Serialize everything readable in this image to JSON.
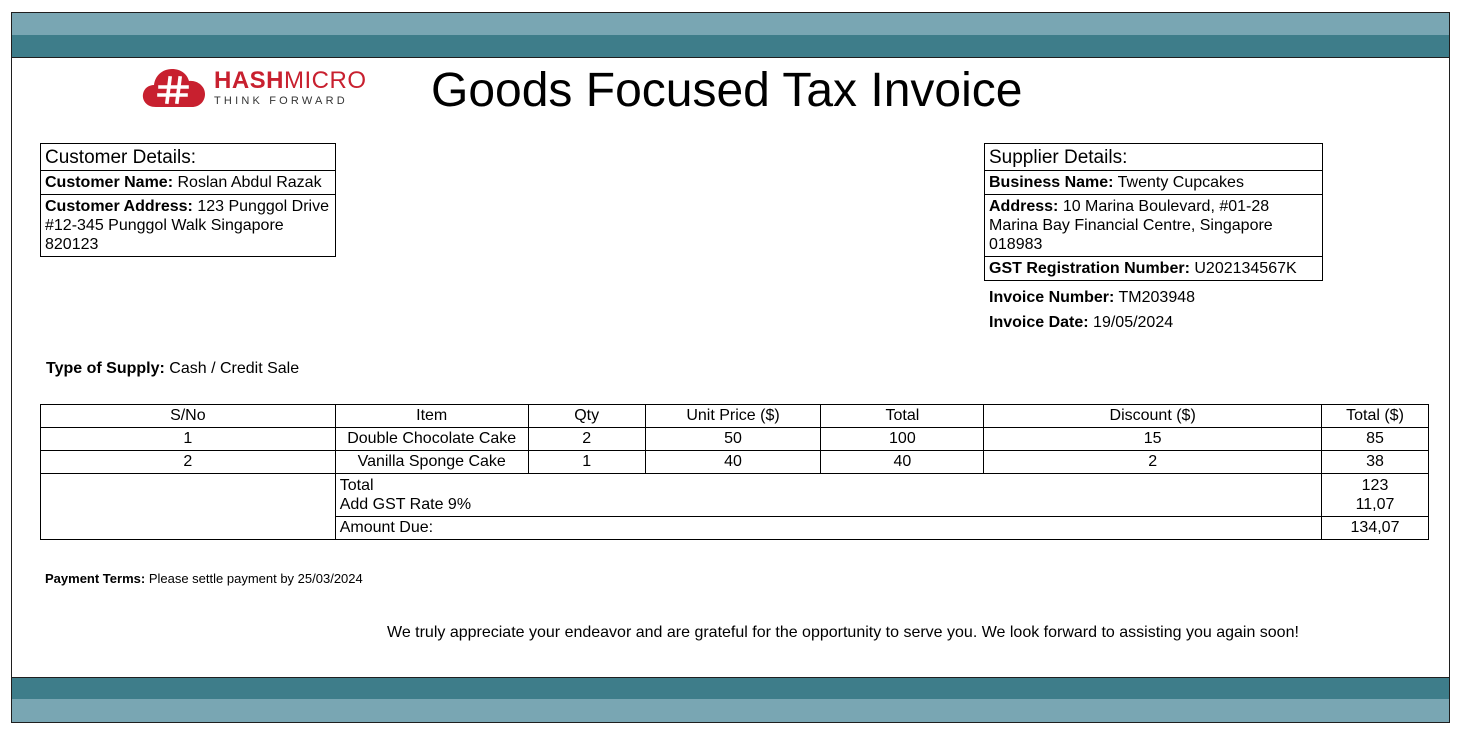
{
  "logo": {
    "brand_hash": "HASH",
    "brand_micro": "MICRO",
    "tagline": "THINK FORWARD",
    "colors": {
      "primary": "#c8202f"
    }
  },
  "title": "Goods Focused Tax Invoice",
  "customer": {
    "heading": "Customer Details:",
    "name_label": "Customer Name:",
    "name": "Roslan Abdul Razak",
    "address_label": "Customer Address:",
    "address_line1": "123 Punggol Drive",
    "address_line2": "#12-345 Punggol Walk Singapore 820123"
  },
  "supplier": {
    "heading": "Supplier Details:",
    "business_label": "Business Name:",
    "business_name": "Twenty Cupcakes",
    "address_label": "Address:",
    "address_line1": "10 Marina Boulevard, #01-28",
    "address_line2": "Marina Bay Financial Centre, Singapore 018983",
    "gst_label": "GST Registration Number:",
    "gst_number": "U202134567K"
  },
  "invoice": {
    "number_label": "Invoice Number:",
    "number": "TM203948",
    "date_label": "Invoice Date:",
    "date": "19/05/2024"
  },
  "supply": {
    "label": "Type of Supply:",
    "value": "Cash / Credit Sale"
  },
  "table": {
    "headers": [
      "S/No",
      "Item",
      "Qty",
      "Unit Price ($)",
      "Total",
      "Discount ($)",
      "Total ($)"
    ],
    "rows": [
      [
        "1",
        "Double Chocolate Cake",
        "2",
        "50",
        "100",
        "15",
        "85"
      ],
      [
        "2",
        "Vanilla Sponge Cake",
        "1",
        "40",
        "40",
        "2",
        "38"
      ]
    ],
    "summary": {
      "total_label": "Total",
      "total_value": "123",
      "gst_label": "Add GST Rate 9%",
      "gst_value": "11,07",
      "due_label": "Amount Due:",
      "due_value": "134,07"
    }
  },
  "payment_terms": {
    "label": "Payment Terms:",
    "value": "Please settle payment by 25/03/2024"
  },
  "thanks": "We truly appreciate your endeavor and are grateful for the opportunity to serve you. We look forward to assisting you again soon!",
  "colors": {
    "band_light": "#79a6b3",
    "band_dark": "#3e7d8a"
  }
}
